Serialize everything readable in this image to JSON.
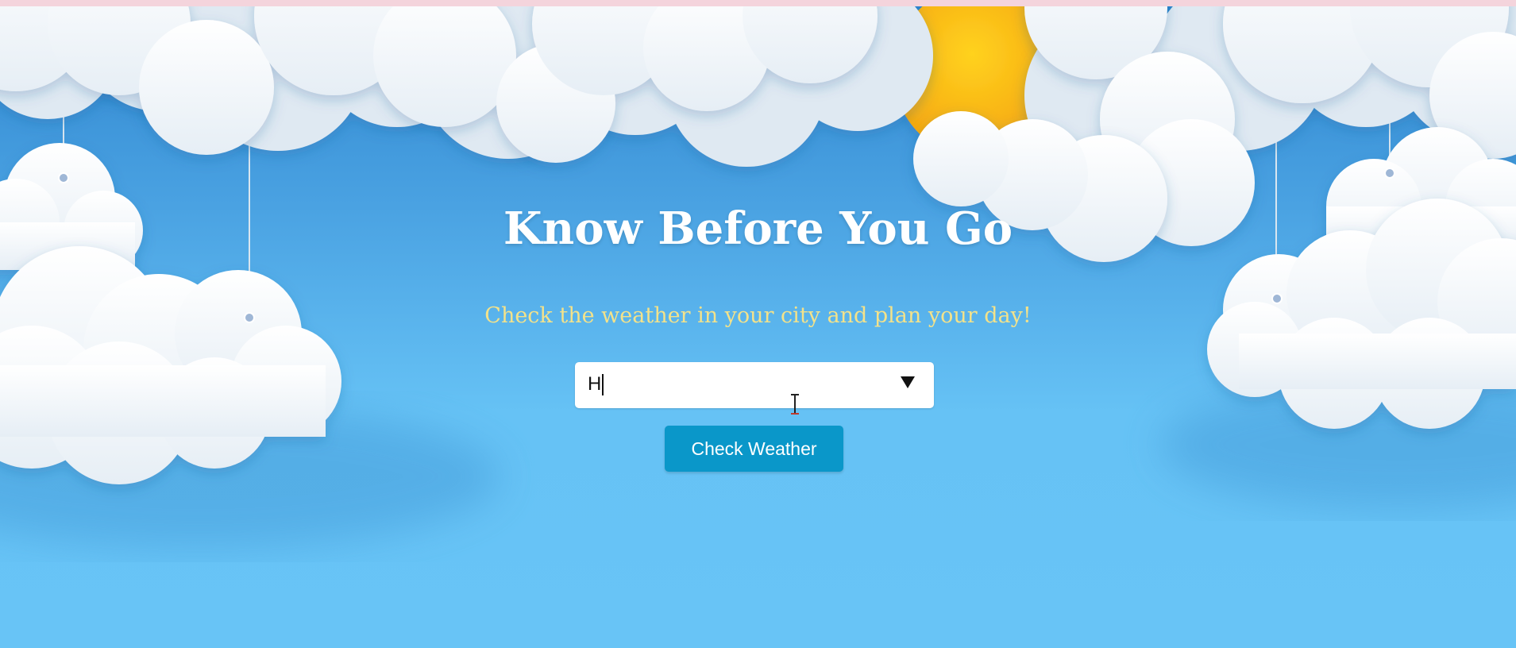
{
  "page": {
    "title": "Know Before You Go",
    "subtitle": "Check the weather in your city and plan your day!"
  },
  "city_select": {
    "value": "H"
  },
  "check_button": {
    "label": "Check Weather"
  },
  "colors": {
    "sky": "#68c3f5",
    "sun": "#fcc21b",
    "title": "#ffffff",
    "subtitle": "#f3e28a",
    "button": "#0a97c9",
    "top_strip": "#f4d4dc"
  },
  "icons": {
    "dropdown": "triangle-down-icon",
    "cursor": "i-beam-cursor-icon"
  }
}
